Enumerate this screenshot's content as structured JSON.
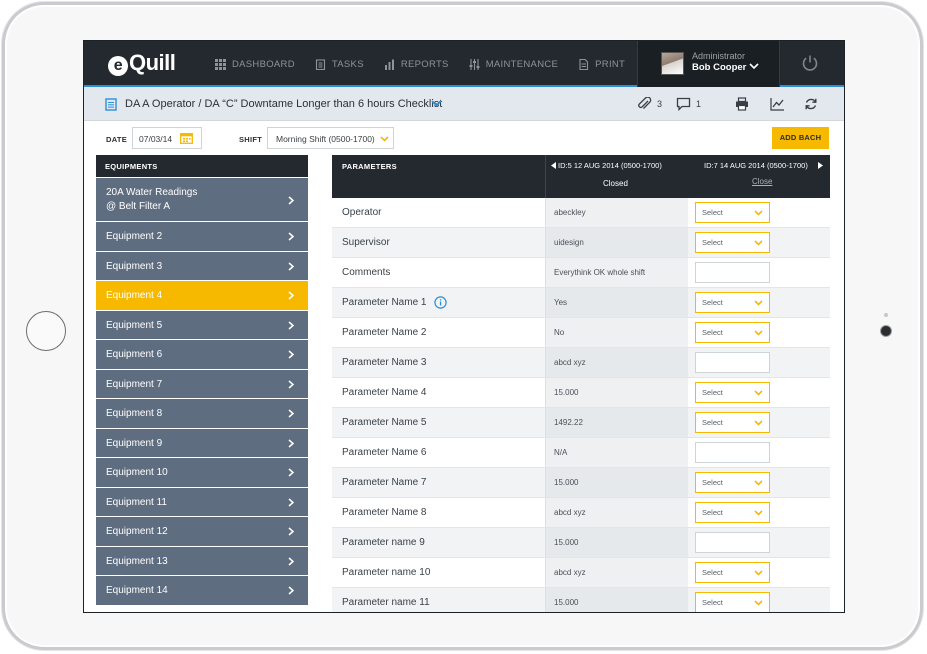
{
  "app": {
    "logo_text": "Quill",
    "logo_e": "e"
  },
  "nav": {
    "items": [
      {
        "label": "DASHBOARD",
        "icon": "grid-icon"
      },
      {
        "label": "TASKS",
        "icon": "clipboard-icon"
      },
      {
        "label": "REPORTS",
        "icon": "bar-chart-icon"
      },
      {
        "label": "MAINTENANCE",
        "icon": "sliders-icon"
      },
      {
        "label": "PRINT",
        "icon": "document-icon"
      }
    ],
    "user": {
      "role": "Administrator",
      "name": "Bob Cooper"
    }
  },
  "subheader": {
    "title": "DA A Operator / DA “C” Downtame Longer than 6 hours Checklist",
    "attachments": "3",
    "comments": "1"
  },
  "filters": {
    "date_label": "DATE",
    "date_value": "07/03/14",
    "shift_label": "SHIFT",
    "shift_value": "Morning Shift (0500-1700)",
    "add_button": "ADD BACH"
  },
  "sidebar": {
    "header": "EQUIPMENTS",
    "items": [
      {
        "label": "20A Water Readings @ Belt Filter A",
        "line1": "20A Water Readings",
        "line2": "@ Belt Filter A"
      },
      {
        "label": "Equipment 2"
      },
      {
        "label": "Equipment 3"
      },
      {
        "label": "Equipment 4",
        "active": true
      },
      {
        "label": "Equipment 5"
      },
      {
        "label": "Equipment 6"
      },
      {
        "label": "Equipment 7"
      },
      {
        "label": "Equipment 8"
      },
      {
        "label": "Equipment 9"
      },
      {
        "label": "Equipment 10"
      },
      {
        "label": "Equipment 11"
      },
      {
        "label": "Equipment 12"
      },
      {
        "label": "Equipment 13"
      },
      {
        "label": "Equipment 14"
      }
    ]
  },
  "table": {
    "header": {
      "params": "PARAMETERS",
      "col1": "ID:5 12 AUG 2014 (0500-1700)",
      "col1_status": "Closed",
      "col2": "ID:7 14 AUG 2014 (0500-1700)",
      "col2_action": "Close"
    },
    "select_placeholder": "Select",
    "rows": [
      {
        "name": "Operator",
        "value": "abeckley",
        "input": "select"
      },
      {
        "name": "Supervisor",
        "value": "uidesign",
        "input": "select"
      },
      {
        "name": "Comments",
        "value": "Everythink OK whole shift",
        "input": "text"
      },
      {
        "name": "Parameter Name 1",
        "value": "Yes",
        "input": "select",
        "info": true
      },
      {
        "name": "Parameter Name 2",
        "value": "No",
        "input": "select"
      },
      {
        "name": "Parameter Name 3",
        "value": "abcd xyz",
        "input": "text"
      },
      {
        "name": "Parameter Name 4",
        "value": "15.000",
        "input": "select"
      },
      {
        "name": "Parameter Name 5",
        "value": "1492.22",
        "input": "select"
      },
      {
        "name": "Parameter Name 6",
        "value": "N/A",
        "input": "text"
      },
      {
        "name": "Parameter Name 7",
        "value": "15.000",
        "input": "select"
      },
      {
        "name": "Parameter Name 8",
        "value": "abcd xyz",
        "input": "select"
      },
      {
        "name": "Parameter name 9",
        "value": "15.000",
        "input": "text"
      },
      {
        "name": "Parameter name 10",
        "value": "abcd xyz",
        "input": "select"
      },
      {
        "name": "Parameter name 11",
        "value": "15.000",
        "input": "select"
      }
    ]
  },
  "colors": {
    "accent": "#f7b800",
    "nav_bg": "#23292e",
    "sidebar_item": "#5f6d80",
    "link_blue": "#2d8fd5"
  }
}
